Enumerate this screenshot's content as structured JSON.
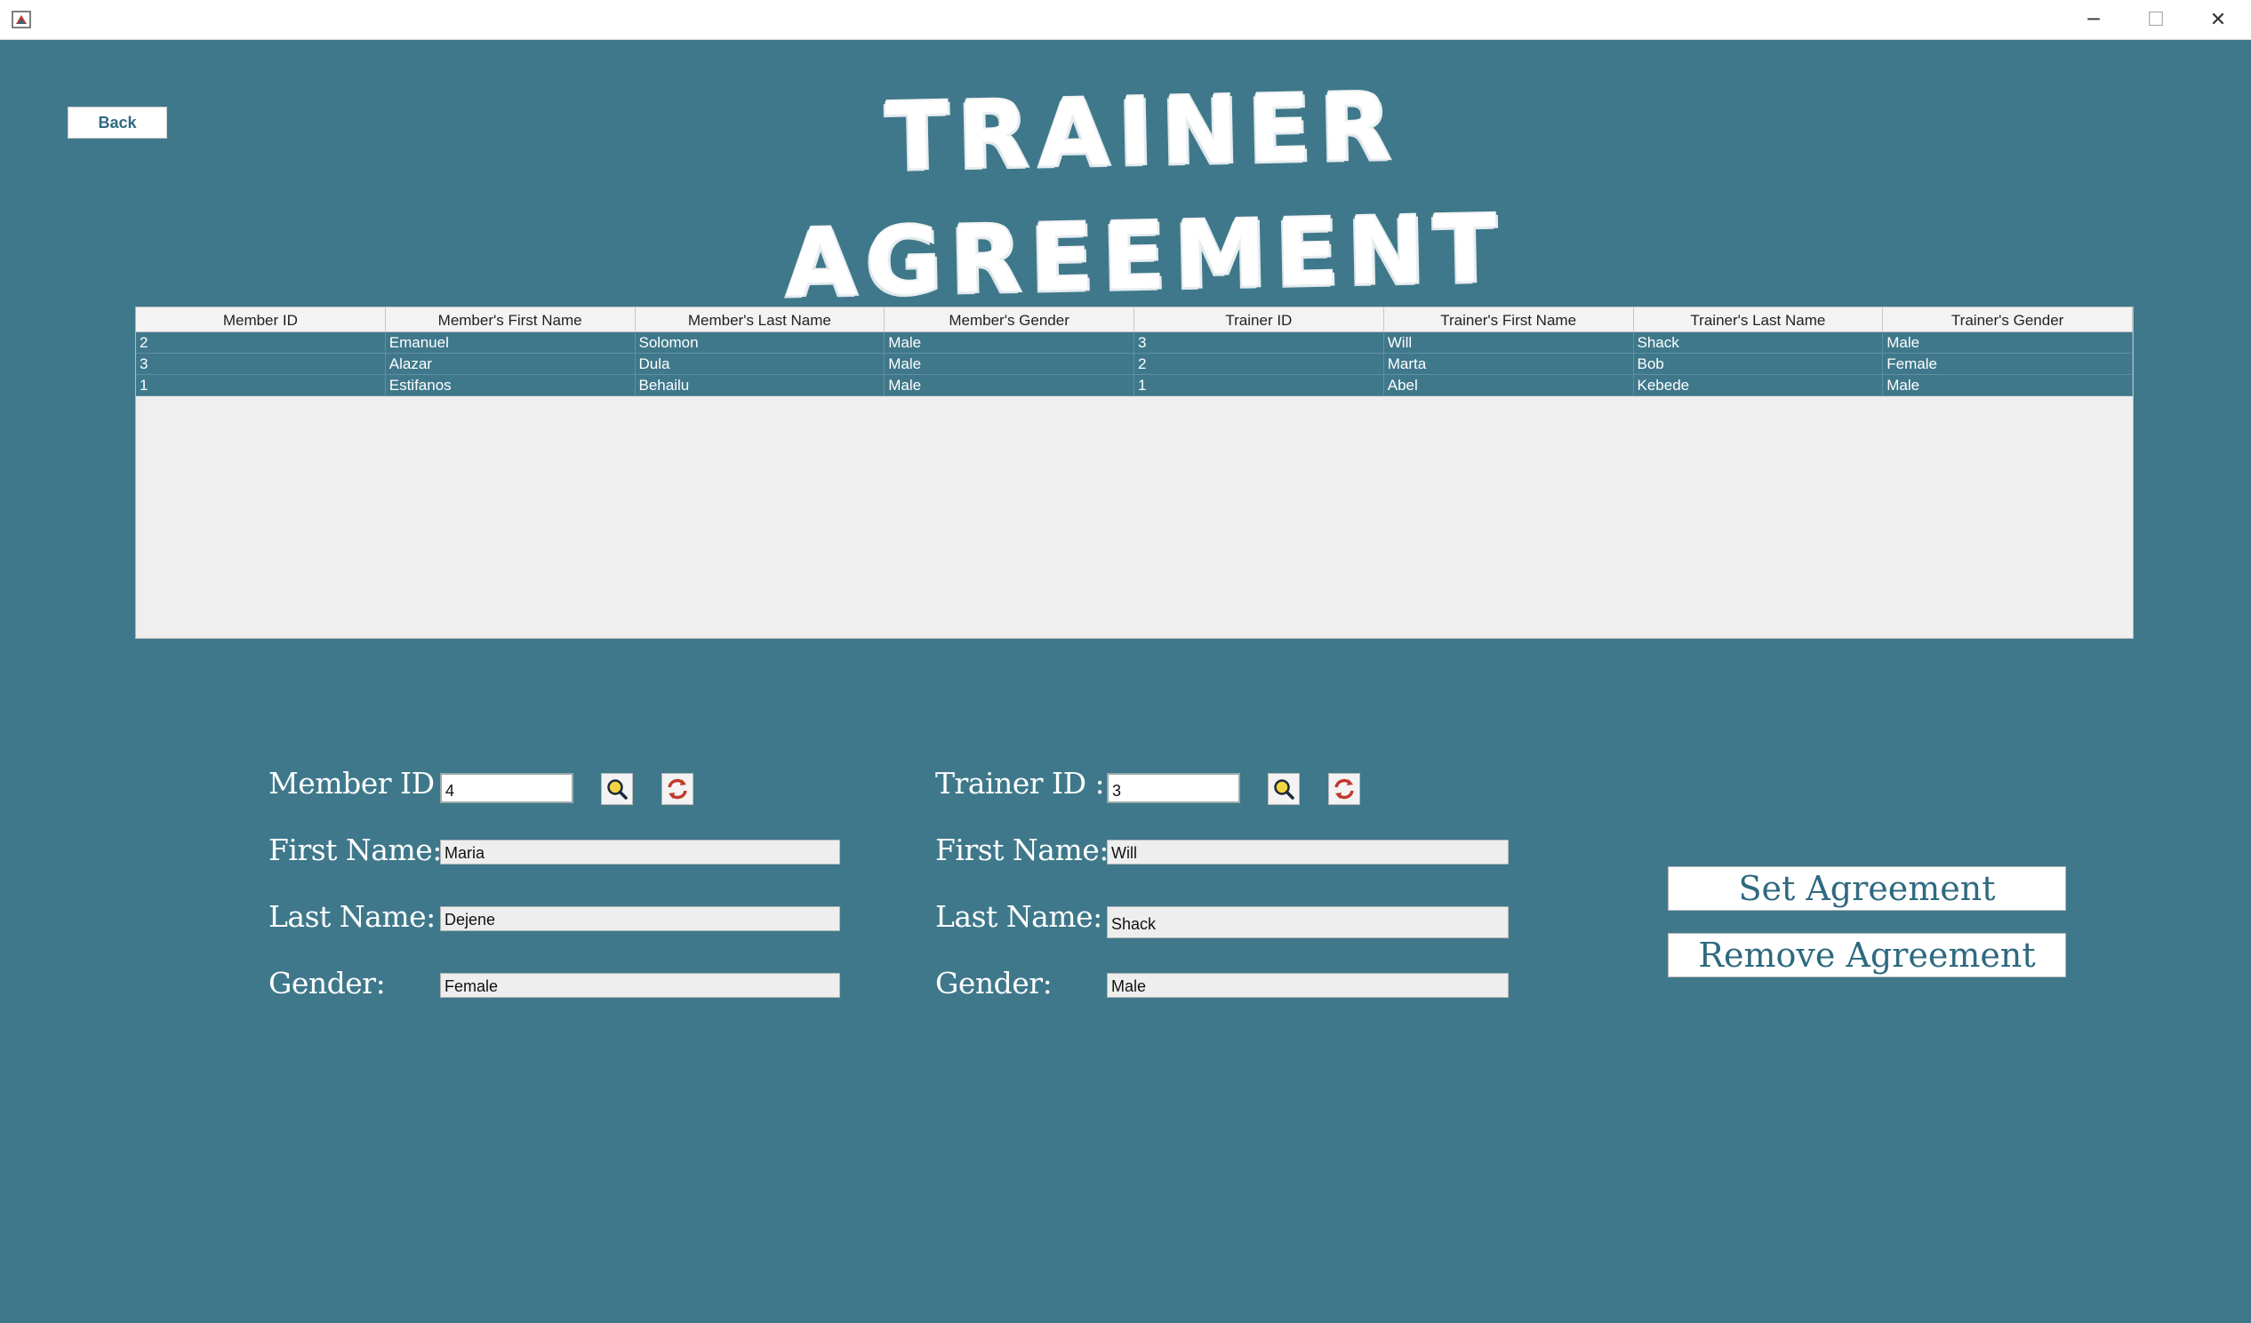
{
  "window": {
    "minimize_glyph": "─",
    "maximize_glyph": "☐",
    "close_glyph": "✕"
  },
  "header": {
    "back_label": "Back",
    "title": "TRAINER AGREEMENT"
  },
  "table": {
    "columns": [
      "Member ID",
      "Member's First Name",
      "Member's Last Name",
      "Member's Gender",
      "Trainer ID",
      "Trainer's First Name",
      "Trainer's Last Name",
      "Trainer's Gender"
    ],
    "rows": [
      [
        "2",
        "Emanuel",
        "Solomon",
        "Male",
        "3",
        "Will",
        "Shack",
        "Male"
      ],
      [
        "3",
        "Alazar",
        "Dula",
        "Male",
        "2",
        "Marta",
        "Bob",
        "Female"
      ],
      [
        "1",
        "Estifanos",
        "Behailu",
        "Male",
        "1",
        "Abel",
        "Kebede",
        "Male"
      ]
    ]
  },
  "member": {
    "id_label": "Member ID :",
    "id_value": "4",
    "first_name_label": "First Name:",
    "first_name_value": "Maria",
    "last_name_label": "Last Name:",
    "last_name_value": "Dejene",
    "gender_label": "Gender:",
    "gender_value": "Female"
  },
  "trainer": {
    "id_label": "Trainer ID :",
    "id_value": "3",
    "first_name_label": "First Name:",
    "first_name_value": "Will",
    "last_name_label": "Last Name:",
    "last_name_value": "Shack",
    "gender_label": "Gender:",
    "gender_value": "Male"
  },
  "actions": {
    "set_label": "Set Agreement",
    "remove_label": "Remove Agreement"
  },
  "icons": {
    "search": "search-icon",
    "refresh": "refresh-icon"
  },
  "colors": {
    "background": "#3f788b",
    "button_text": "#2e6a80",
    "search_icon": "#e0a800",
    "refresh_icon": "#c0392b"
  }
}
